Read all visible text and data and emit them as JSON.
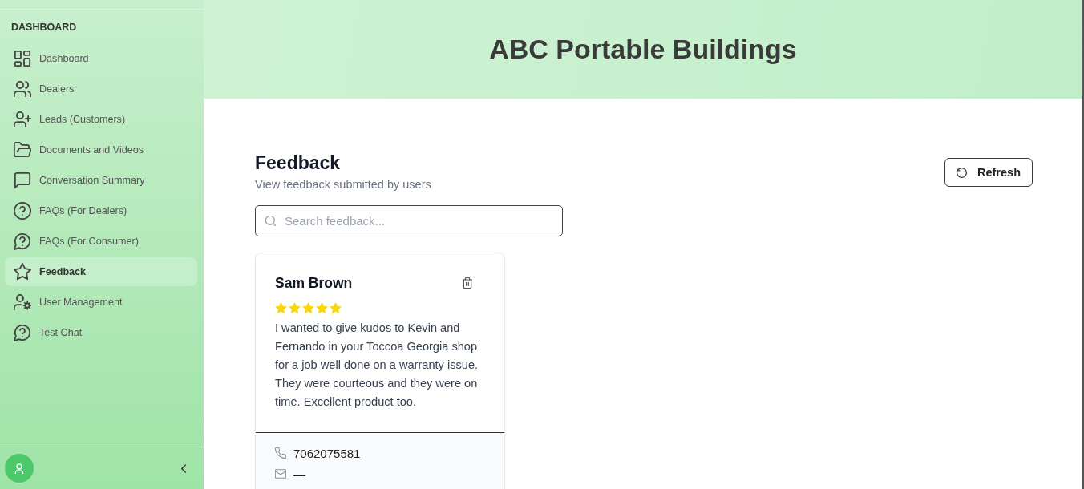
{
  "sidebar": {
    "section_title": "DASHBOARD",
    "items": [
      {
        "label": "Dashboard",
        "selected": false
      },
      {
        "label": "Dealers",
        "selected": false
      },
      {
        "label": "Leads (Customers)",
        "selected": false
      },
      {
        "label": "Documents and Videos",
        "selected": false
      },
      {
        "label": "Conversation Summary",
        "selected": false
      },
      {
        "label": "FAQs (For Dealers)",
        "selected": false
      },
      {
        "label": "FAQs (For Consumer)",
        "selected": false
      },
      {
        "label": "Feedback",
        "selected": true
      },
      {
        "label": "User Management",
        "selected": false
      },
      {
        "label": "Test Chat",
        "selected": false
      }
    ]
  },
  "header": {
    "title": "ABC Portable Buildings"
  },
  "page": {
    "title": "Feedback",
    "subtitle": "View feedback submitted by users",
    "refresh_button": "Refresh",
    "search": {
      "placeholder": "Search feedback..."
    }
  },
  "feedback_cards": [
    {
      "name": "Sam Brown",
      "stars": 5,
      "message": "I wanted to give kudos to Kevin and Fernando in your Toccoa Georgia shop for a job well done on a warranty issue. They were courteous and they were on time. Excellent product too.",
      "phone": "7062075581",
      "email": "—"
    }
  ]
}
